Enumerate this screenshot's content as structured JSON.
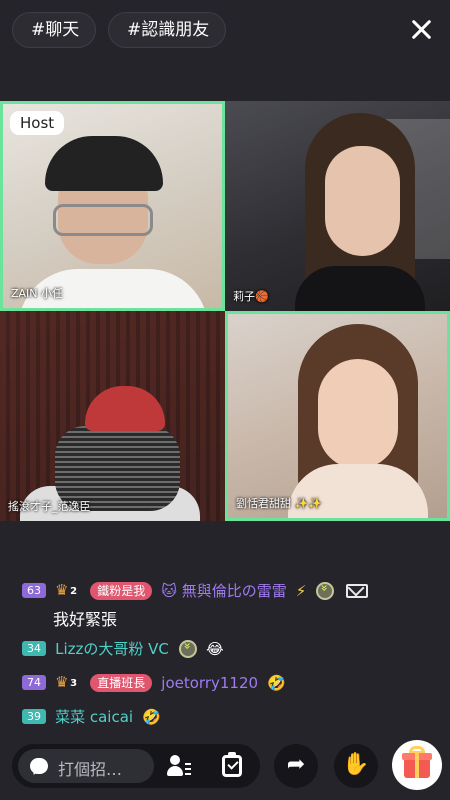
{
  "top_bar": {
    "tags": [
      "#聊天",
      "#認識朋友"
    ]
  },
  "video_grid": {
    "host_label": "Host",
    "participants": [
      {
        "name": "ZAIN 小任"
      },
      {
        "name": "莉子🏀"
      },
      {
        "name": "搖滾才子_范逸臣"
      },
      {
        "name": "劉恬君甜甜 ✨✨"
      }
    ]
  },
  "chat": {
    "messages": [
      {
        "level": "63",
        "level_color": "#8e6ad8",
        "crown_level": "2",
        "fan_badge": "鐵粉是我",
        "fan_color": "#e0566f",
        "username": "🐱 無與倫比の雷雷",
        "username_color": "#9e7cf0",
        "text": "我好緊張"
      },
      {
        "level": "34",
        "level_color": "#3fb8b0",
        "username": "Lizzの大哥粉 VC",
        "username_color": "#4fd1c8",
        "emoji": "😂"
      },
      {
        "level": "74",
        "level_color": "#8e6ad8",
        "crown_level": "3",
        "fan_badge": "直播班長",
        "fan_color": "#e0566f",
        "username": "joetorry1120",
        "username_color": "#9e7cf0",
        "emoji": "🤣"
      },
      {
        "level": "39",
        "level_color": "#3fb8b0",
        "username": "菜菜 caicai",
        "username_color": "#4fd1c8",
        "emoji": "🤣"
      }
    ]
  },
  "bottom_bar": {
    "input_placeholder": "打個招…",
    "share_icon": "share-arrow",
    "hand_icon": "raise-hand",
    "gift_icon": "gift"
  }
}
